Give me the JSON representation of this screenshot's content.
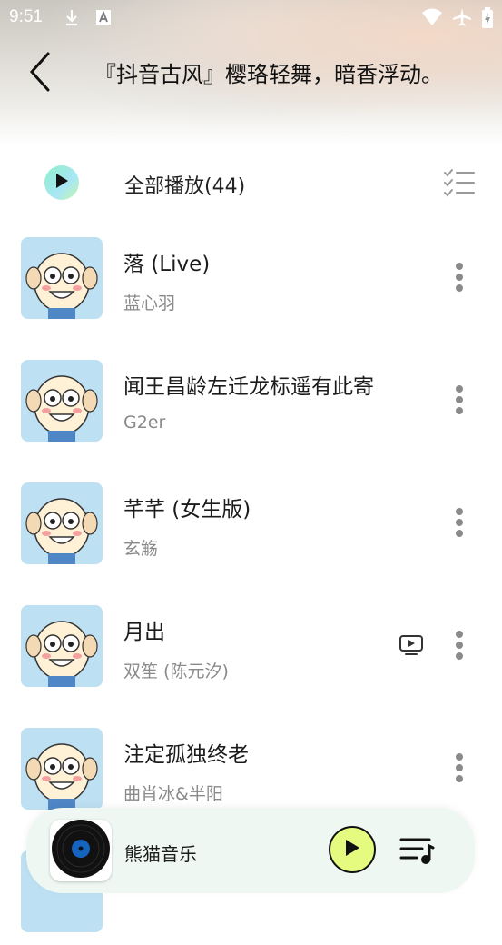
{
  "status_bar": {
    "time": "9:51",
    "left_icons": [
      "download-icon",
      "font-a-icon"
    ],
    "right_icons": [
      "wifi-icon",
      "airplane-icon",
      "battery-icon"
    ]
  },
  "header": {
    "title": "『抖音古风』樱珞轻舞，暗香浮动。"
  },
  "play_all": {
    "label": "全部播放(44)"
  },
  "songs": [
    {
      "title": "落 (Live)",
      "artist": "蓝心羽",
      "has_mv": false
    },
    {
      "title": "闻王昌龄左迁龙标遥有此寄",
      "artist": "G2er",
      "has_mv": false
    },
    {
      "title": "芊芊 (女生版)",
      "artist": "玄觞",
      "has_mv": false
    },
    {
      "title": "月出",
      "artist": "双笙 (陈元汐)",
      "has_mv": true
    },
    {
      "title": "注定孤独终老",
      "artist": "曲肖冰&半阳",
      "has_mv": false
    }
  ],
  "mini_player": {
    "title": "熊猫音乐"
  },
  "colors": {
    "accent_play": "#e4fb7f",
    "play_all_gradient_start": "#8ff0c8",
    "secondary_text": "#8a8a8a"
  }
}
